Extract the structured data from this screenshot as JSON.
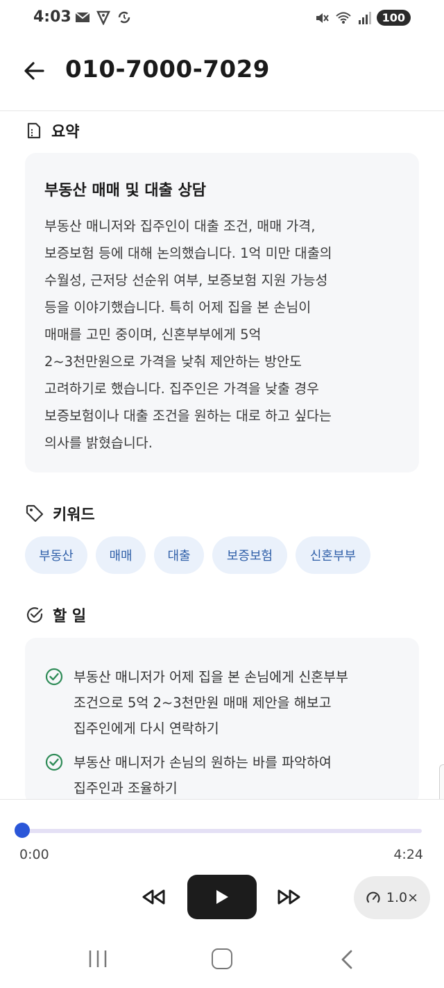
{
  "status_bar": {
    "time": "4:03",
    "battery": "100",
    "icons_left": [
      "mail-icon",
      "shield-icon",
      "sync-icon"
    ],
    "icons_right": [
      "mute-icon",
      "wifi-icon",
      "signal-icon"
    ]
  },
  "header": {
    "title": "010-7000-7029"
  },
  "summary": {
    "section_label": "요약",
    "title": "부동산 매매 및 대출 상담",
    "body": "부동산 매니저와 집주인이 대출 조건, 매매 가격,\n보증보험 등에 대해 논의했습니다. 1억 미만 대출의\n수월성, 근저당 선순위 여부, 보증보험 지원 가능성\n등을 이야기했습니다. 특히 어제 집을 본 손님이\n매매를 고민 중이며, 신혼부부에게 5억\n2~3천만원으로 가격을 낮춰 제안하는 방안도\n고려하기로 했습니다. 집주인은 가격을 낮출 경우\n보증보험이나 대출 조건을 원하는 대로 하고 싶다는\n의사를 밝혔습니다."
  },
  "keywords": {
    "section_label": "키워드",
    "items": [
      "부동산",
      "매매",
      "대출",
      "보증보험",
      "신혼부부"
    ]
  },
  "todos": {
    "section_label": "할 일",
    "items": [
      "부동산 매니저가 어제 집을 본 손님에게 신혼부부\n조건으로 5억 2~3천만원 매매 제안을 해보고\n집주인에게 다시 연락하기",
      "부동산 매니저가 손님의 원하는 바를 파악하여\n집주인과 조율하기"
    ]
  },
  "player": {
    "current_time": "0:00",
    "total_time": "4:24",
    "progress": 0,
    "speed": "1.0×"
  },
  "colors": {
    "accent": "#2a56d8",
    "chip_bg": "#eaf1fb",
    "chip_text": "#2f5fa8",
    "check": "#2e8b57",
    "card_bg": "#f6f7f9"
  }
}
